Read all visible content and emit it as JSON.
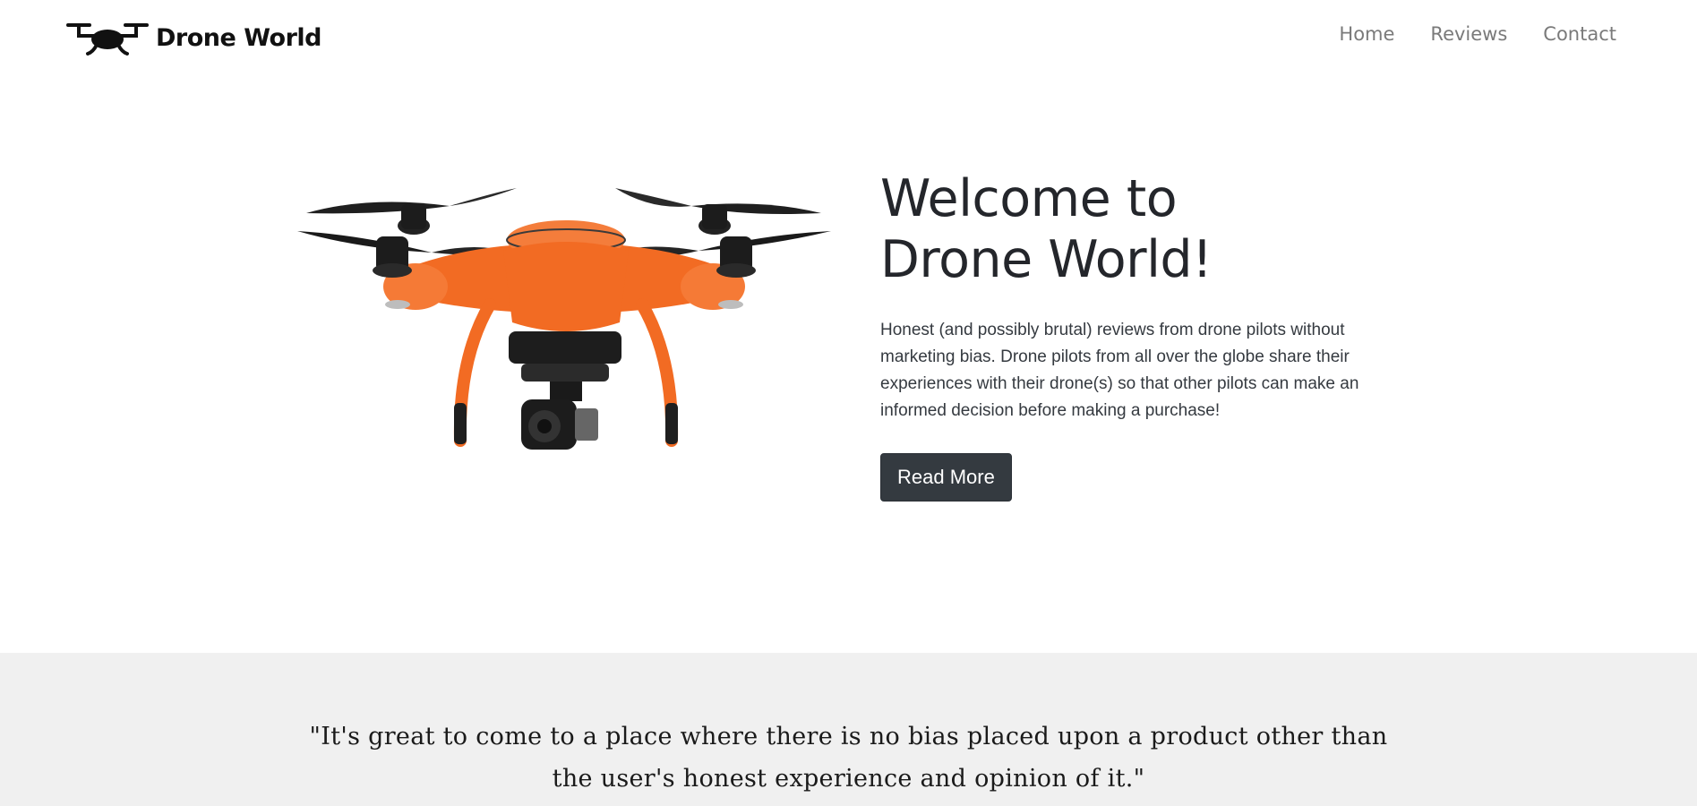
{
  "brand": {
    "name": "Drone World",
    "logo_icon": "drone-icon"
  },
  "nav": {
    "items": [
      {
        "label": "Home"
      },
      {
        "label": "Reviews"
      },
      {
        "label": "Contact"
      }
    ]
  },
  "hero": {
    "title": "Welcome to Drone World!",
    "description": "Honest (and possibly brutal) reviews from drone pilots without marketing bias. Drone pilots from all over the globe share their experiences with their drone(s) so that other pilots can make an informed decision before making a purchase!",
    "button_label": "Read More",
    "image": "orange-quadcopter-drone-image"
  },
  "testimonial": {
    "quote": "\"It's great to come to a place where there is no bias placed upon a product other than the user's honest experience and opinion of it.\""
  },
  "colors": {
    "drone_orange": "#f26b23",
    "button_dark": "#343a40",
    "band_gray": "#f0f0f0",
    "nav_link_gray": "#7a7a7a"
  }
}
